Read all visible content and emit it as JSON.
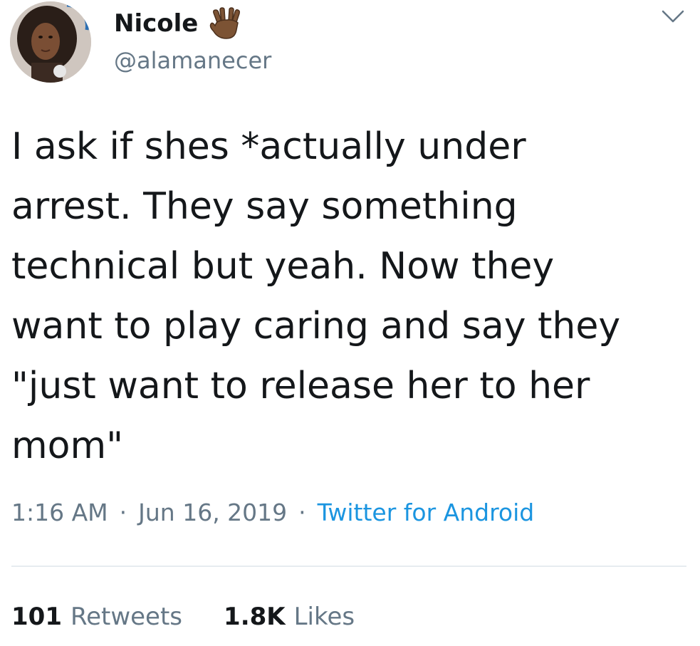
{
  "author": {
    "display_name": "Nicole",
    "handle": "@alamanecer",
    "badge_emoji": "vulcan-salute-icon"
  },
  "tweet": {
    "text": "I ask if shes *actually under\narrest. They say something\ntechnical but yeah. Now they\nwant to play caring and say they\n\"just want to release her to her\nmom\"",
    "time": "1:16 AM",
    "separator": "·",
    "date": "Jun 16, 2019",
    "source": "Twitter for Android"
  },
  "stats": {
    "retweets_count": "101",
    "retweets_label": "Retweets",
    "likes_count": "1.8K",
    "likes_label": "Likes"
  },
  "colors": {
    "text": "#14171a",
    "secondary": "#657786",
    "link": "#1b95e0",
    "divider": "#e6ecf0"
  }
}
